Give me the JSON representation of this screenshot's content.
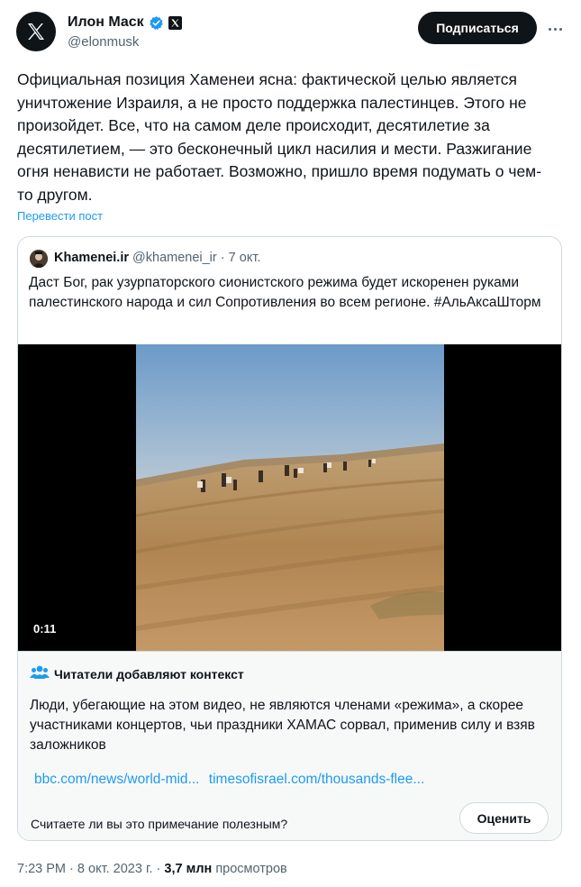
{
  "author": {
    "name": "Илон Маск",
    "handle": "@elonmusk",
    "verified": true,
    "avatar_icon": "x-logo-icon"
  },
  "actions": {
    "subscribe_label": "Подписаться",
    "more_icon": "more-options-icon"
  },
  "post": {
    "text": "Официальная позиция Хаменеи ясна: фактической целью является уничтожение Израиля, а не просто поддержка палестинцев. Этого не произойдет. Все, что на самом деле происходит, десятилетие за десятилетием, — это бесконечный цикл насилия и мести. Разжигание огня ненависти не работает. Возможно, пришло время подумать о чем-то другом.",
    "translate_label": "Перевести пост"
  },
  "quote": {
    "name": "Khamenei.ir",
    "handle": "@khamenei_ir",
    "separator": "·",
    "date": "7 окт.",
    "text": "Даст Бог, рак узурпаторского сионистского режима будет искоренен руками палестинского народа и сил Сопротивления во всем регионе. #АльАксаШторм",
    "video_time": "0:11"
  },
  "community_note": {
    "title": "Читатели добавляют контекст",
    "text": "Люди, убегающие на этом видео, не являются членами «режима», а скорее участниками концертов, чьи праздники ХАМАС сорвал, применив силу и взяв заложников",
    "links": [
      "bbc.com/news/world-mid...",
      "timesofisrael.com/thousands-flee..."
    ],
    "question": "Считаете ли вы это примечание полезным?",
    "rate_label": "Оценить"
  },
  "footer": {
    "time": "7:23 PM",
    "date": "8 окт. 2023 г.",
    "views_count": "3,7 млн",
    "views_label": "просмотров"
  },
  "colors": {
    "accent": "#1d9bf0",
    "text": "#0f1419",
    "secondary": "#536471",
    "border": "#cfd9de",
    "note_bg": "#f7f9f9"
  }
}
